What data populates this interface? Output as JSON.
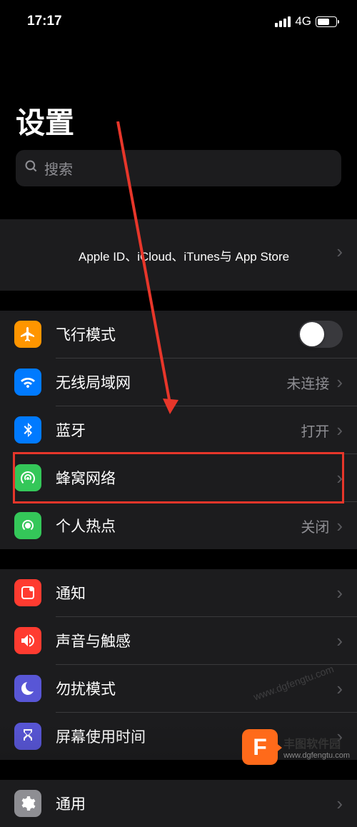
{
  "status": {
    "time": "17:17",
    "network_type": "4G"
  },
  "page": {
    "title": "设置"
  },
  "search": {
    "placeholder": "搜索"
  },
  "apple_id": {
    "text": "Apple ID、iCloud、iTunes与 App Store"
  },
  "rows": {
    "airplane": {
      "label": "飞行模式"
    },
    "wifi": {
      "label": "无线局域网",
      "value": "未连接"
    },
    "bluetooth": {
      "label": "蓝牙",
      "value": "打开"
    },
    "cellular": {
      "label": "蜂窝网络"
    },
    "hotspot": {
      "label": "个人热点",
      "value": "关闭"
    },
    "notification": {
      "label": "通知"
    },
    "sound": {
      "label": "声音与触感"
    },
    "dnd": {
      "label": "勿扰模式"
    },
    "screentime": {
      "label": "屏幕使用时间"
    },
    "general": {
      "label": "通用"
    }
  },
  "watermark": {
    "title": "丰图软件园",
    "url": "www.dgfengtu.com",
    "logo": "F"
  }
}
